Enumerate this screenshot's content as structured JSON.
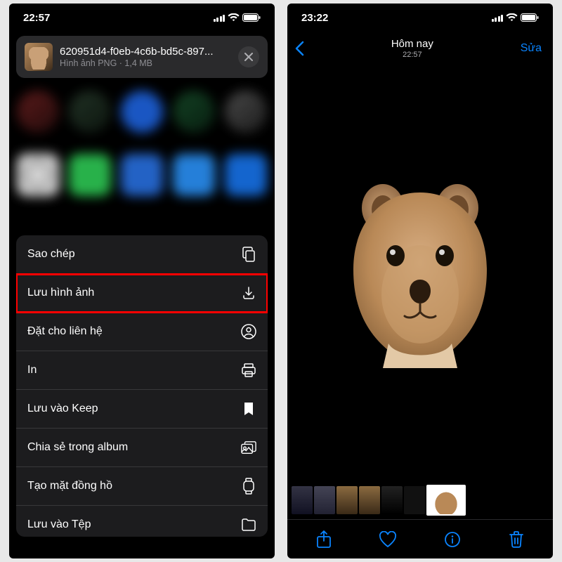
{
  "left": {
    "status_time": "22:57",
    "file": {
      "name": "620951d4-f0eb-4c6b-bd5c-897...",
      "meta": "Hình ảnh PNG · 1,4 MB"
    },
    "actions": [
      {
        "label": "Sao chép",
        "icon": "copy"
      },
      {
        "label": "Lưu hình ảnh",
        "icon": "download",
        "highlight": true
      },
      {
        "label": "Đặt cho liên hệ",
        "icon": "contact"
      },
      {
        "label": "In",
        "icon": "print"
      },
      {
        "label": "Lưu vào Keep",
        "icon": "bookmark"
      },
      {
        "label": "Chia sẻ trong album",
        "icon": "shared-album"
      },
      {
        "label": "Tạo mặt đồng hồ",
        "icon": "watch"
      },
      {
        "label": "Lưu vào Tệp",
        "icon": "folder"
      }
    ]
  },
  "right": {
    "status_time": "23:22",
    "nav": {
      "title": "Hôm nay",
      "subtitle": "22:57",
      "edit": "Sửa"
    }
  }
}
